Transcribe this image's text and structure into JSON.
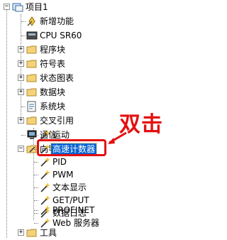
{
  "tree": {
    "root": {
      "label": "项目1",
      "expander": "−"
    },
    "items": [
      {
        "label": "新增功能",
        "icon": "new-feature-icon"
      },
      {
        "label": "CPU SR60",
        "icon": "cpu-icon"
      },
      {
        "label": "程序块",
        "icon": "folder-icon",
        "expander": "+"
      },
      {
        "label": "符号表",
        "icon": "folder-icon",
        "expander": "+"
      },
      {
        "label": "状态图表",
        "icon": "folder-icon",
        "expander": "+"
      },
      {
        "label": "数据块",
        "icon": "folder-icon",
        "expander": "+"
      },
      {
        "label": "系统块",
        "icon": "system-block-icon"
      },
      {
        "label": "交叉引用",
        "icon": "folder-icon",
        "expander": "+"
      },
      {
        "label": "通信",
        "icon": "communication-icon"
      },
      {
        "label": "向导",
        "icon": "wizard-folder-icon",
        "expander": "−"
      }
    ],
    "wizard_items": [
      {
        "label": "运动"
      },
      {
        "label": "高速计数器",
        "selected": true
      },
      {
        "label": "PID"
      },
      {
        "label": "PWM"
      },
      {
        "label": "文本显示"
      },
      {
        "label": "GET/PUT"
      },
      {
        "label": "数据日志"
      },
      {
        "label": "PROFINET"
      },
      {
        "label": "Web 服务器"
      }
    ],
    "tools": {
      "label": "工具",
      "icon": "folder-icon",
      "expander": "+"
    }
  },
  "annotation": {
    "text": "双击",
    "color": "#e3100f"
  },
  "colors": {
    "selection": "#0a64d2",
    "annotation": "#e3100f"
  }
}
